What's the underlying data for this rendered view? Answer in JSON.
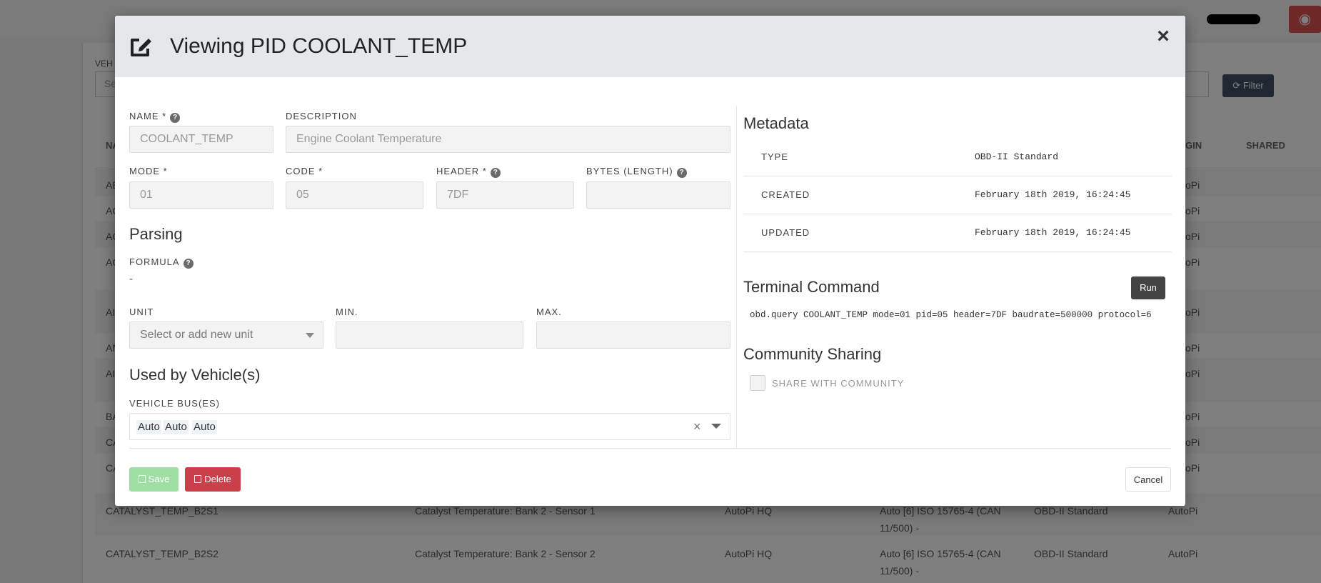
{
  "background": {
    "vehicle_label": "VEH",
    "search_placeholder": "Se",
    "filter_label": "Filter",
    "columns": {
      "name": "NA",
      "origin": "GIN",
      "shared": "SHARED"
    },
    "rows": [
      {
        "name": "AE",
        "origin": "oPi"
      },
      {
        "name": "AC",
        "origin": "oPi"
      },
      {
        "name": "AC",
        "origin": "oPi"
      },
      {
        "name": "AC",
        "origin": "oPi"
      },
      {
        "name": "AI",
        "origin": "oPi"
      },
      {
        "name": "AN",
        "origin": "oPi"
      },
      {
        "name": "AI",
        "origin": "oPi"
      },
      {
        "name": "BA",
        "origin": "oPi"
      },
      {
        "name": "CA",
        "origin": "oPi"
      },
      {
        "name": "CA",
        "origin": "oPi"
      },
      {
        "name": "CATALYST_TEMP_B2S1",
        "description": "Catalyst Temperature: Bank 2 - Sensor 1",
        "owner": "AutoPi HQ",
        "bus_line1": "Auto [6] ISO 15765-4 (CAN",
        "bus_line2": "11/500) -",
        "type": "OBD-II Standard",
        "origin": "AutoPi"
      },
      {
        "name": "CATALYST_TEMP_B2S2",
        "description": "Catalyst Temperature: Bank 2 - Sensor 2",
        "owner": "AutoPi HQ",
        "bus_line1": "Auto [6] ISO 15765-4 (CAN",
        "bus_line2": "11/500) -",
        "type": "OBD-II Standard",
        "origin": "AutoPi"
      }
    ]
  },
  "modal": {
    "title": "Viewing PID COOLANT_TEMP",
    "close_symbol": "×",
    "fields": {
      "name_label": "NAME *",
      "name_value": "COOLANT_TEMP",
      "description_label": "DESCRIPTION",
      "description_value": "Engine Coolant Temperature",
      "mode_label": "MODE *",
      "mode_value": "01",
      "code_label": "CODE *",
      "code_value": "05",
      "header_label": "HEADER *",
      "header_value": "7DF",
      "bytes_label": "BYTES (LENGTH)",
      "bytes_value": ""
    },
    "parsing": {
      "title": "Parsing",
      "formula_label": "FORMULA",
      "formula_value": "-",
      "unit_label": "UNIT",
      "unit_placeholder": "Select or add new unit",
      "min_label": "MIN.",
      "min_value": "",
      "max_label": "MAX.",
      "max_value": ""
    },
    "vehicles": {
      "title": "Used by Vehicle(s)",
      "bus_label": "VEHICLE BUS(ES)",
      "tags": [
        "Auto",
        "Auto",
        "Auto"
      ],
      "clear_symbol": "×"
    },
    "metadata": {
      "title": "Metadata",
      "rows": [
        {
          "key": "TYPE",
          "value": "OBD-II Standard"
        },
        {
          "key": "CREATED",
          "value": "February 18th 2019, 16:24:45"
        },
        {
          "key": "UPDATED",
          "value": "February 18th 2019, 16:24:45"
        }
      ]
    },
    "terminal": {
      "title": "Terminal Command",
      "run_label": "Run",
      "command": "obd.query COOLANT_TEMP mode=01 pid=05 header=7DF baudrate=500000 protocol=6"
    },
    "community": {
      "title": "Community Sharing",
      "share_label": "SHARE WITH COMMUNITY",
      "checked": false
    },
    "buttons": {
      "save": "Save",
      "delete": "Delete",
      "cancel": "Cancel"
    }
  },
  "colors": {
    "header_bg": "#e5e8eb",
    "save_button": "#9fdfa3",
    "delete_button": "#c9404a",
    "run_button": "#444444",
    "filter_button": "#3e4f60",
    "globe_button": "#d9534f"
  }
}
